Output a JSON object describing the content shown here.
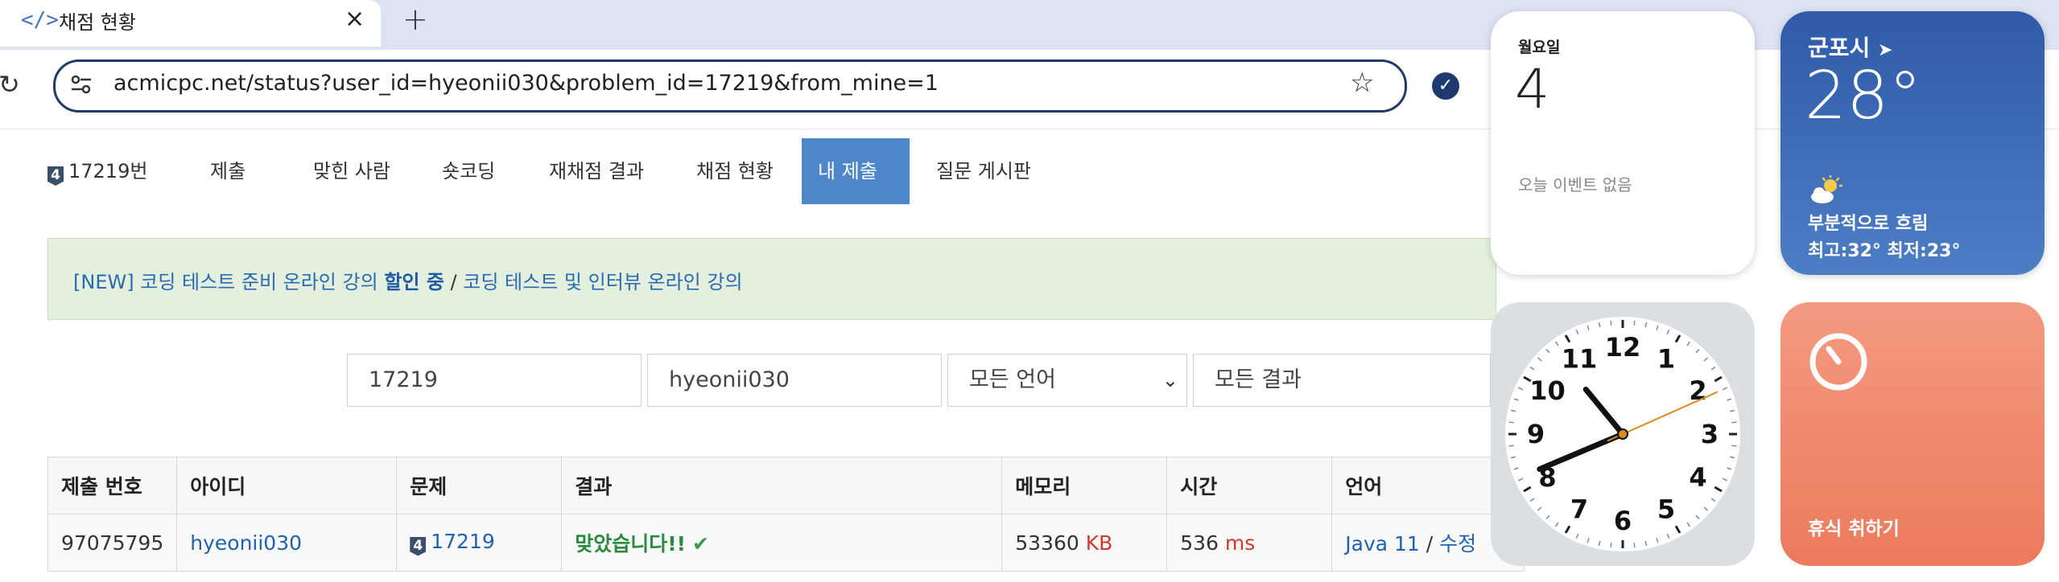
{
  "browser": {
    "tab_title": "채점 현황",
    "tab_favicon": "</>",
    "new_tab": "+",
    "close_symbol": "×",
    "url": "acmicpc.net/status?user_id=hyeonii030&problem_id=17219&from_mine=1"
  },
  "nav": {
    "badge": "4",
    "problem": "17219번",
    "items": [
      "제출",
      "맞힌 사람",
      "숏코딩",
      "재채점 결과",
      "채점 현황",
      "내 제출",
      "질문 게시판"
    ],
    "active": "내 제출"
  },
  "notice": {
    "part1": "[NEW] 코딩 테스트 준비 온라인 강의 ",
    "bold": "할인 중",
    "sep": " / ",
    "part2": "코딩 테스트 및 인터뷰 온라인 강의"
  },
  "filters": {
    "problem_id": "17219",
    "user_id": "hyeonii030",
    "language": "모든 언어",
    "result": "모든 결과"
  },
  "table": {
    "headers": [
      "제출 번호",
      "아이디",
      "문제",
      "결과",
      "메모리",
      "시간",
      "언어"
    ],
    "row": {
      "submission_id": "97075795",
      "user": "hyeonii030",
      "problem_badge": "4",
      "problem": "17219",
      "result": "맞았습니다!!",
      "result_mark": "✔",
      "memory": "53360",
      "memory_unit": "KB",
      "time": "536",
      "time_unit": "ms",
      "language": "Java 11",
      "sep": " / ",
      "edit": "수정"
    }
  },
  "widgets": {
    "calendar": {
      "day": "월요일",
      "date": "4",
      "no_event": "오늘 이벤트 없음"
    },
    "weather": {
      "city": "군포시",
      "temp": "28°",
      "condition": "부분적으로 흐림",
      "range": "최고:32° 최저:23°",
      "icon": "partly-cloudy-icon"
    },
    "clock": {
      "numbers": [
        "12",
        "1",
        "2",
        "3",
        "4",
        "5",
        "6",
        "7",
        "8",
        "9",
        "10",
        "11"
      ],
      "hour": 10,
      "minute": 41,
      "second": 11
    },
    "timer": {
      "label": "휴식 취하기"
    }
  }
}
